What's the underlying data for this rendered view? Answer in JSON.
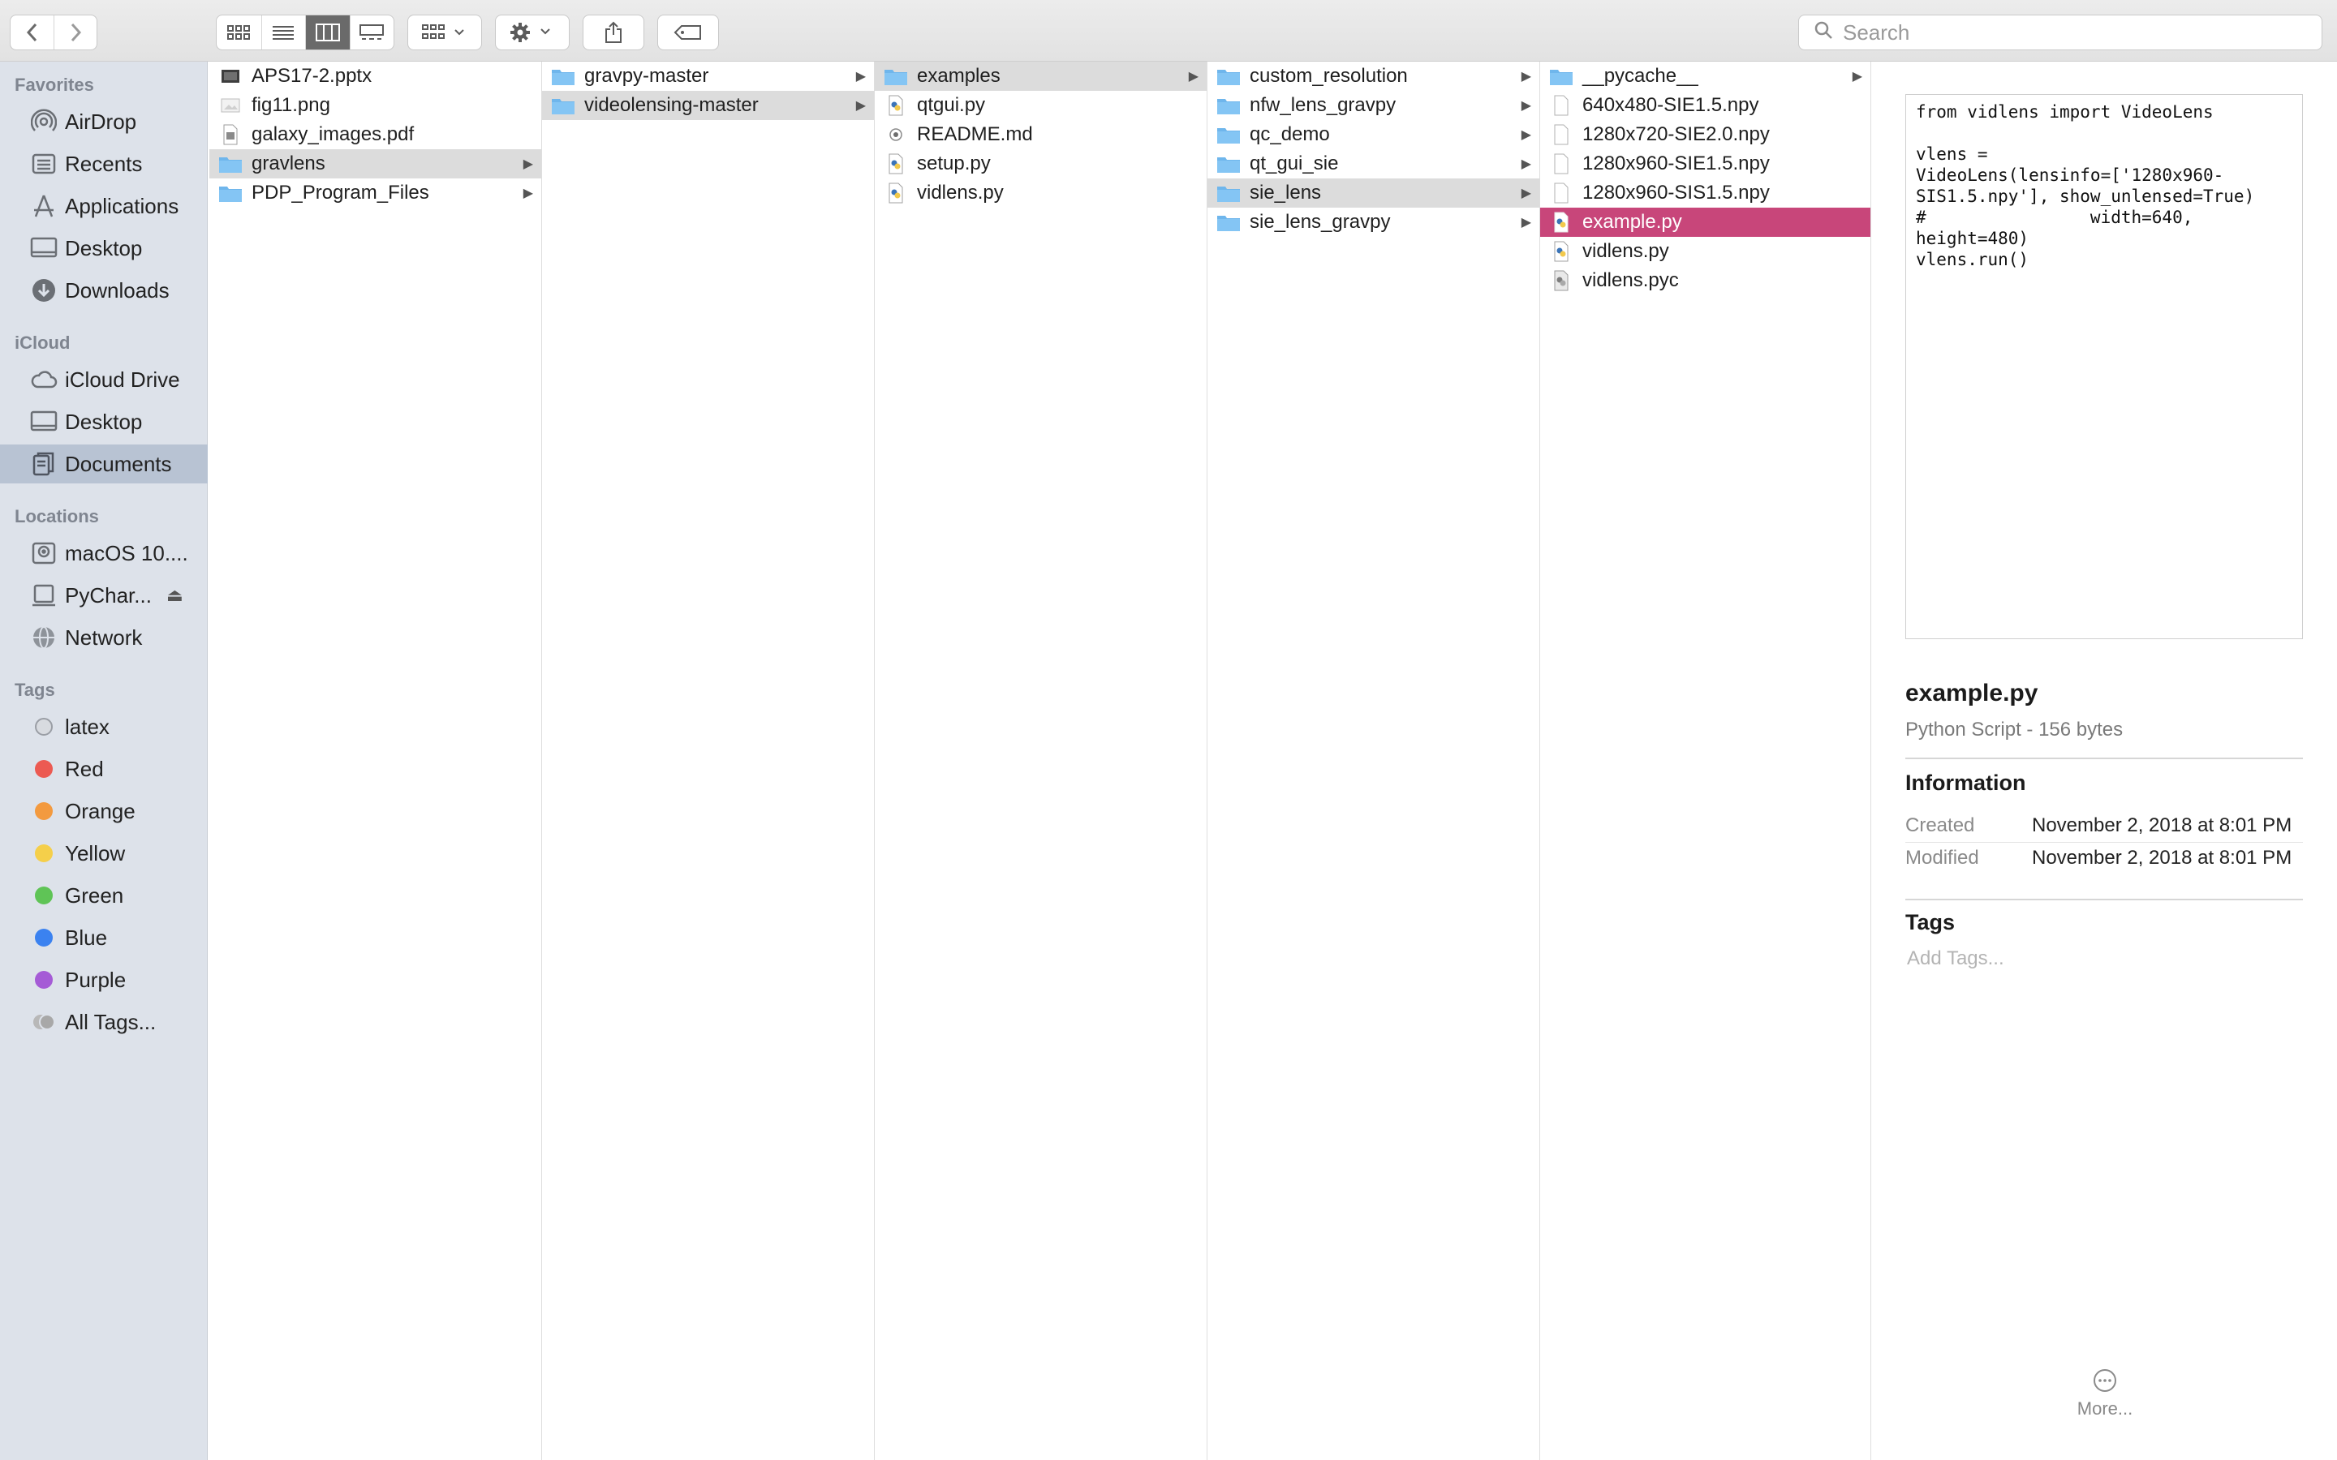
{
  "toolbar": {
    "search_placeholder": "Search",
    "icons": [
      "back-icon",
      "forward-icon",
      "icon-view-icon",
      "list-view-icon",
      "column-view-icon",
      "gallery-view-icon",
      "group-icon",
      "action-gear-icon",
      "share-icon",
      "tag-icon",
      "search-icon"
    ]
  },
  "sidebar": {
    "favorites_header": "Favorites",
    "favorites": [
      {
        "label": "AirDrop",
        "icon": "airdrop-icon"
      },
      {
        "label": "Recents",
        "icon": "recents-icon"
      },
      {
        "label": "Applications",
        "icon": "applications-icon"
      },
      {
        "label": "Desktop",
        "icon": "desktop-icon"
      },
      {
        "label": "Downloads",
        "icon": "downloads-icon"
      }
    ],
    "icloud_header": "iCloud",
    "icloud": [
      {
        "label": "iCloud Drive",
        "icon": "icloud-drive-icon"
      },
      {
        "label": "Desktop",
        "icon": "desktop-icon"
      },
      {
        "label": "Documents",
        "icon": "documents-icon",
        "selected": true
      }
    ],
    "locations_header": "Locations",
    "locations": [
      {
        "label": "macOS 10....",
        "icon": "hard-drive-icon"
      },
      {
        "label": "PyChar...",
        "icon": "disk-icon"
      },
      {
        "label": "Network",
        "icon": "network-icon"
      }
    ],
    "tags_header": "Tags",
    "tags": [
      {
        "label": "latex",
        "color": "#c9c9c9"
      },
      {
        "label": "Red",
        "color": "#ec5a52"
      },
      {
        "label": "Orange",
        "color": "#f39a3f"
      },
      {
        "label": "Yellow",
        "color": "#f5cf4a"
      },
      {
        "label": "Green",
        "color": "#5fc456"
      },
      {
        "label": "Blue",
        "color": "#3b82f0"
      },
      {
        "label": "Purple",
        "color": "#a55bd6"
      },
      {
        "label": "All Tags...",
        "color": "#b8b8b8"
      }
    ]
  },
  "columns": [
    {
      "items": [
        {
          "name": "APS17-2.pptx",
          "kind": "pptx"
        },
        {
          "name": "fig11.png",
          "kind": "image"
        },
        {
          "name": "galaxy_images.pdf",
          "kind": "pdf"
        },
        {
          "name": "gravlens",
          "kind": "folder",
          "state": "path",
          "arrow": true
        },
        {
          "name": "PDP_Program_Files",
          "kind": "folder",
          "arrow": true
        }
      ]
    },
    {
      "items": [
        {
          "name": "gravpy-master",
          "kind": "folder",
          "arrow": true
        },
        {
          "name": "videolensing-master",
          "kind": "folder",
          "state": "path",
          "arrow": true
        }
      ]
    },
    {
      "items": [
        {
          "name": "examples",
          "kind": "folder",
          "state": "path",
          "arrow": true
        },
        {
          "name": "qtgui.py",
          "kind": "python"
        },
        {
          "name": "README.md",
          "kind": "markdown"
        },
        {
          "name": "setup.py",
          "kind": "python"
        },
        {
          "name": "vidlens.py",
          "kind": "python"
        }
      ]
    },
    {
      "items": [
        {
          "name": "custom_resolution",
          "kind": "folder",
          "arrow": true
        },
        {
          "name": "nfw_lens_gravpy",
          "kind": "folder",
          "arrow": true
        },
        {
          "name": "qc_demo",
          "kind": "folder",
          "arrow": true
        },
        {
          "name": "qt_gui_sie",
          "kind": "folder",
          "arrow": true
        },
        {
          "name": "sie_lens",
          "kind": "folder",
          "state": "path",
          "arrow": true
        },
        {
          "name": "sie_lens_gravpy",
          "kind": "folder",
          "arrow": true
        }
      ]
    },
    {
      "items": [
        {
          "name": "__pycache__",
          "kind": "folder",
          "arrow": true
        },
        {
          "name": "640x480-SIE1.5.npy",
          "kind": "doc"
        },
        {
          "name": "1280x720-SIE2.0.npy",
          "kind": "doc"
        },
        {
          "name": "1280x960-SIE1.5.npy",
          "kind": "doc"
        },
        {
          "name": "1280x960-SIS1.5.npy",
          "kind": "doc"
        },
        {
          "name": "example.py",
          "kind": "python",
          "state": "selected"
        },
        {
          "name": "vidlens.py",
          "kind": "python"
        },
        {
          "name": "vidlens.pyc",
          "kind": "compiled"
        }
      ]
    }
  ],
  "preview": {
    "code": "from vidlens import VideoLens\n\nvlens =\nVideoLens(lensinfo=['1280x960-\nSIS1.5.npy'], show_unlensed=True)\n#                width=640,\nheight=480)\nvlens.run()",
    "file_name": "example.py",
    "file_kind": "Python Script - 156 bytes",
    "info_header": "Information",
    "created_label": "Created",
    "created_value": "November 2, 2018 at 8:01 PM",
    "modified_label": "Modified",
    "modified_value": "November 2, 2018 at 8:01 PM",
    "tags_header": "Tags",
    "add_tags_placeholder": "Add Tags...",
    "more_label": "More..."
  },
  "colors": {
    "selected_row": "#c8467a",
    "sidebar_bg": "#dde2ea",
    "sidebar_selected": "#b8c3d3",
    "folder_blue": "#7cc0f0"
  }
}
